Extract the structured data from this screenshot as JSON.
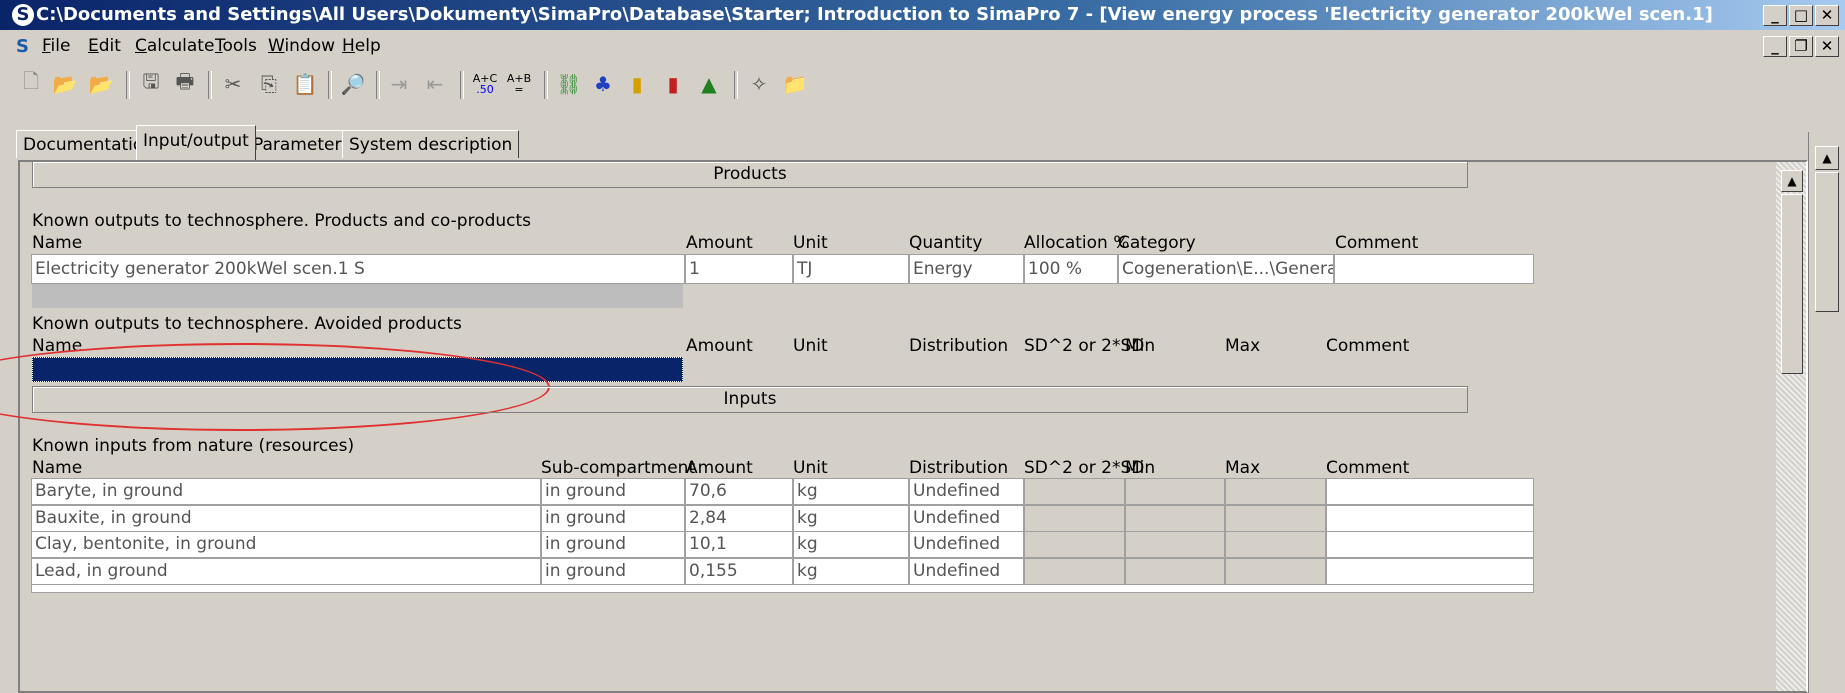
{
  "window": {
    "title": "C:\\Documents and Settings\\All Users\\Dokumenty\\SimaPro\\Database\\Starter; Introduction to SimaPro 7 - [View energy process 'Electricity generator 200kWel scen.1]",
    "app_icon": "S"
  },
  "menu": [
    "File",
    "Edit",
    "Calculate",
    "Tools",
    "Window",
    "Help"
  ],
  "menu_accel": [
    "F",
    "E",
    "C",
    "T",
    "W",
    "H"
  ],
  "menu_rest": [
    "ile",
    "dit",
    "alculate",
    "ools",
    "indow",
    "elp"
  ],
  "toolbar": {
    "icons": [
      "new-icon",
      "open-icon",
      "open-project-icon",
      "save-icon",
      "print-icon",
      "cut-icon",
      "copy-icon",
      "paste-icon",
      "search-icon",
      "indent-icon",
      "outdent-icon",
      "calculate-icon",
      "compare-icon",
      "network-icon",
      "tree-icon",
      "bar-chart-icon",
      "stacked-chart-icon",
      "monte-carlo-icon",
      "wizard-icon",
      "folder-icon"
    ],
    "calc_label_top": "A+C",
    "calc_label_bottom": ".50",
    "compare_label_top": "A+B",
    "compare_label_bottom": "="
  },
  "tabs": [
    "Documentation",
    "Input/output",
    "Parameters",
    "System description"
  ],
  "active_tab": "Input/output",
  "products": {
    "section_title": "Products",
    "known_outputs_title": "Known outputs to technosphere. Products and co-products",
    "headers": [
      "Name",
      "Amount",
      "Unit",
      "Quantity",
      "Allocation %",
      "Category",
      "Comment"
    ],
    "row": {
      "name": "Electricity generator 200kWel scen.1 S",
      "amount": "1",
      "unit": "TJ",
      "quantity": "Energy",
      "allocation": "100 %",
      "category": "Cogeneration\\E...\\Generator",
      "comment": ""
    },
    "avoided_title": "Known outputs to technosphere. Avoided products",
    "avoided_headers": [
      "Name",
      "Amount",
      "Unit",
      "Distribution",
      "SD^2 or 2*SD",
      "Min",
      "Max",
      "Comment"
    ]
  },
  "inputs": {
    "section_title": "Inputs",
    "resources_title": "Known inputs from nature (resources)",
    "headers": [
      "Name",
      "Sub-compartment",
      "Amount",
      "Unit",
      "Distribution",
      "SD^2 or 2*SD",
      "Min",
      "Max",
      "Comment"
    ],
    "rows": [
      {
        "name": "Baryte, in ground",
        "sub": "in ground",
        "amount": "70,6",
        "unit": "kg",
        "dist": "Undefined"
      },
      {
        "name": "Bauxite, in ground",
        "sub": "in ground",
        "amount": "2,84",
        "unit": "kg",
        "dist": "Undefined"
      },
      {
        "name": "Clay, bentonite, in ground",
        "sub": "in ground",
        "amount": "10,1",
        "unit": "kg",
        "dist": "Undefined"
      },
      {
        "name": "Lead, in ground",
        "sub": "in ground",
        "amount": "0,155",
        "unit": "kg",
        "dist": "Undefined"
      }
    ]
  }
}
